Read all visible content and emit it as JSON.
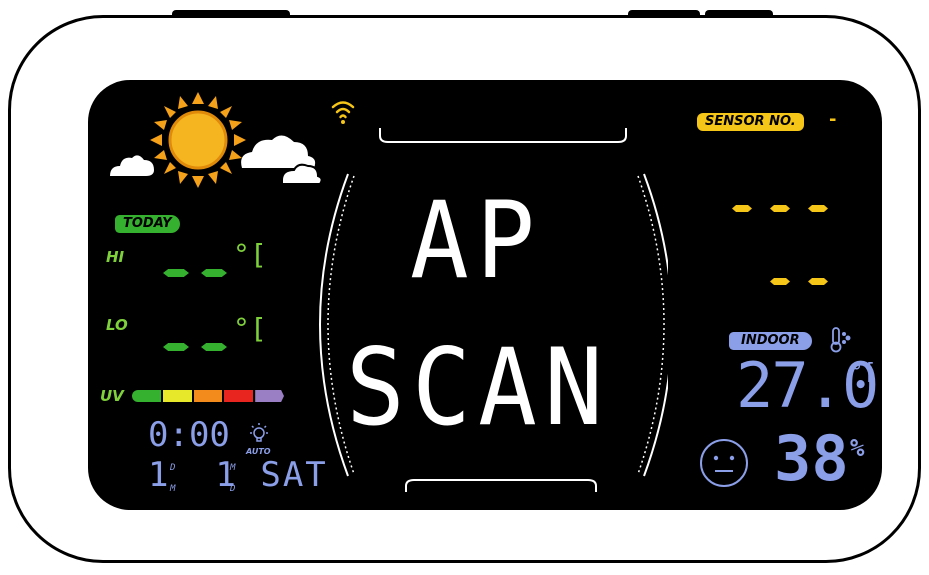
{
  "display": {
    "main_line1": "AP",
    "main_line2": "SCAN",
    "sensor_label": "SENSOR  NO.",
    "sensor_value": "-",
    "today_label": "TODAY",
    "hi_label": "HI",
    "lo_label": "LO",
    "temp_unit": "°[",
    "uv_label": "UV",
    "clock_time": "0:00",
    "auto_label": "AUTO",
    "date_line": "1  1 SAT",
    "date_d": "D",
    "date_m": "M",
    "date_m2": "M",
    "date_d2": "D",
    "indoor_label": "INDOOR",
    "indoor_temp": "27.0",
    "indoor_temp_unit": "°[",
    "indoor_humidity": "38",
    "humidity_unit": "%"
  },
  "colors": {
    "bezel": "#ffffff",
    "screen": "#000000",
    "accent_yellow": "#f5c518",
    "accent_green": "#35b02f",
    "indoor_blue": "#8b9ee8",
    "uv_scale": [
      "#35b02f",
      "#e8e82a",
      "#f38a1c",
      "#e8251f",
      "#9b7fc4"
    ]
  },
  "icons": {
    "weather": "sun-cloud-icon",
    "wifi": "wifi-icon",
    "thermometer": "thermometer-icon",
    "comfort": "neutral-face-icon",
    "backlight": "lightbulb-icon"
  }
}
